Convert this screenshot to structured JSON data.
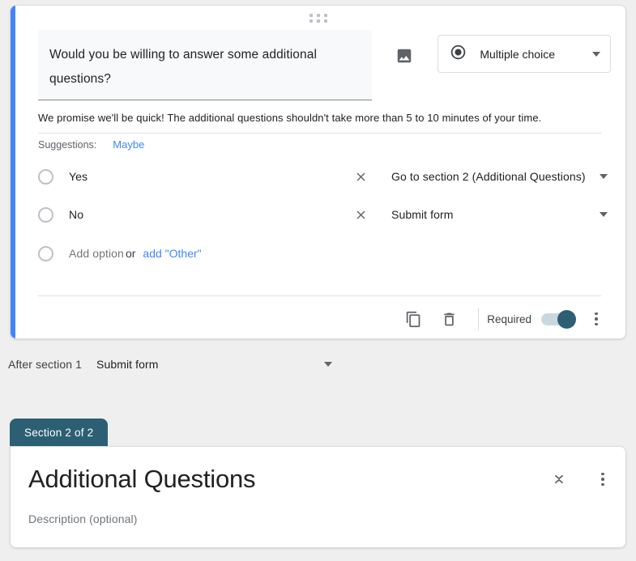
{
  "question_card": {
    "drag_handle": "drag-handle",
    "title": "Would you be willing to answer some additional questions?",
    "description": "We promise we'll be quick! The additional questions shouldn't take more than 5 to 10 minutes of your time.",
    "image_button": "insert-image",
    "question_type": {
      "label": "Multiple choice",
      "icon": "radio-button-icon"
    },
    "suggestions": {
      "label": "Suggestions:",
      "items": [
        "Maybe"
      ]
    },
    "options": [
      {
        "label": "Yes",
        "remove": "×",
        "goto": "Go to section 2 (Additional Questions)"
      },
      {
        "label": "No",
        "remove": "×",
        "goto": "Submit form"
      }
    ],
    "add_option": {
      "label": "Add option",
      "or": "or",
      "add_other": "add \"Other\""
    },
    "footer": {
      "duplicate_icon": "duplicate-icon",
      "delete_icon": "trash-icon",
      "required_label": "Required",
      "required_on": true,
      "more_icon": "more-options-icon"
    }
  },
  "after_section": {
    "label": "After section 1",
    "value": "Submit form"
  },
  "section2": {
    "tab_label": "Section 2 of 2",
    "title": "Additional Questions",
    "description_placeholder": "Description (optional)",
    "collapse_icon": "collapse-icon",
    "more_icon": "more-options-icon"
  },
  "colors": {
    "accent_blue": "#4285f4",
    "section_teal": "#2c5f73",
    "page_background": "#efefef",
    "link_blue": "#4285f4"
  }
}
